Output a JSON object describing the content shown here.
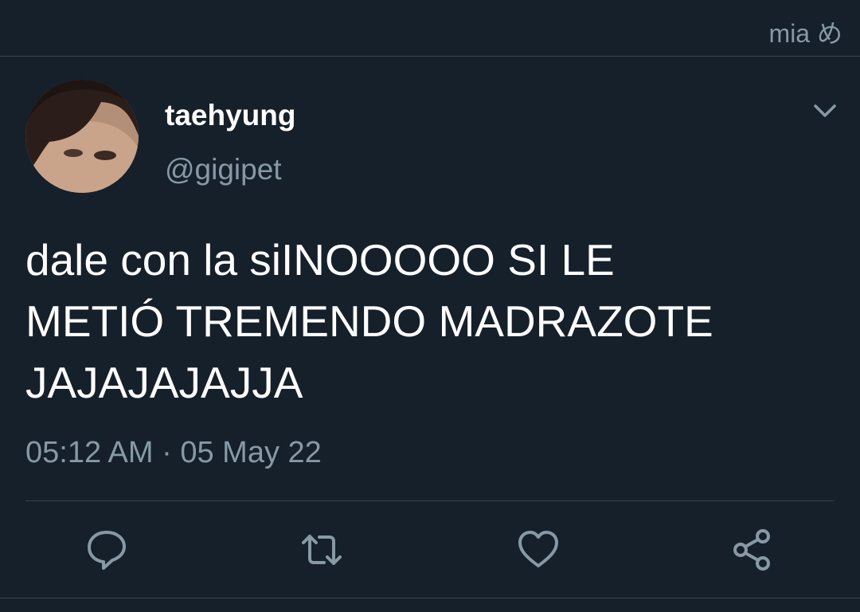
{
  "topbar": {
    "username": "mia め"
  },
  "tweet": {
    "author_name": "taehyung",
    "author_handle": "@gigipet",
    "text": "dale con la siINOOOOO SI LE\nMETIÓ TREMENDO MADRAZOTE\nJAJAJAJAJJA",
    "time": "05:12 AM",
    "separator": "·",
    "date": "05 May 22"
  },
  "actions": [
    {
      "icon": "reply-icon"
    },
    {
      "icon": "retweet-icon"
    },
    {
      "icon": "like-icon"
    },
    {
      "icon": "share-icon"
    }
  ],
  "colors": {
    "background": "#15202b",
    "secondary_text": "#8899a6",
    "divider": "#38444d"
  }
}
